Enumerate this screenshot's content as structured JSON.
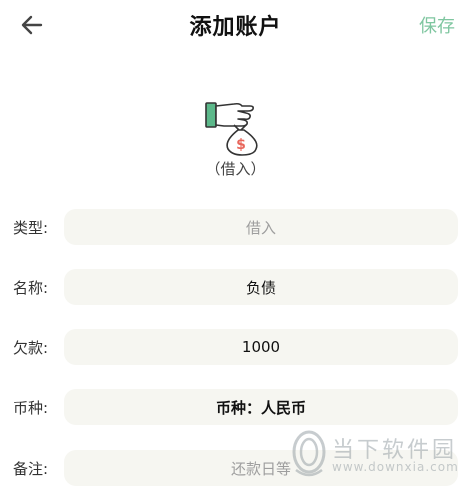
{
  "header": {
    "title": "添加账户",
    "save_label": "保存",
    "back_icon": "arrow-left-icon"
  },
  "hero": {
    "icon": "money-bag-hand-icon",
    "caption": "（借入）"
  },
  "form": {
    "type": {
      "label": "类型:",
      "value": "借入"
    },
    "name": {
      "label": "名称:",
      "value": "负债"
    },
    "debt": {
      "label": "欠款:",
      "value": "1000"
    },
    "currency": {
      "label": "币种:",
      "value": "币种：人民币"
    },
    "note": {
      "label": "备注:",
      "placeholder": "还款日等"
    }
  },
  "watermark": {
    "text": "当下软件园",
    "url": "www.downxia.com"
  },
  "colors": {
    "accent": "#7fc6a0",
    "field_bg": "#f6f6f1",
    "icon_green": "#4caf7a",
    "icon_red": "#e8665b"
  }
}
